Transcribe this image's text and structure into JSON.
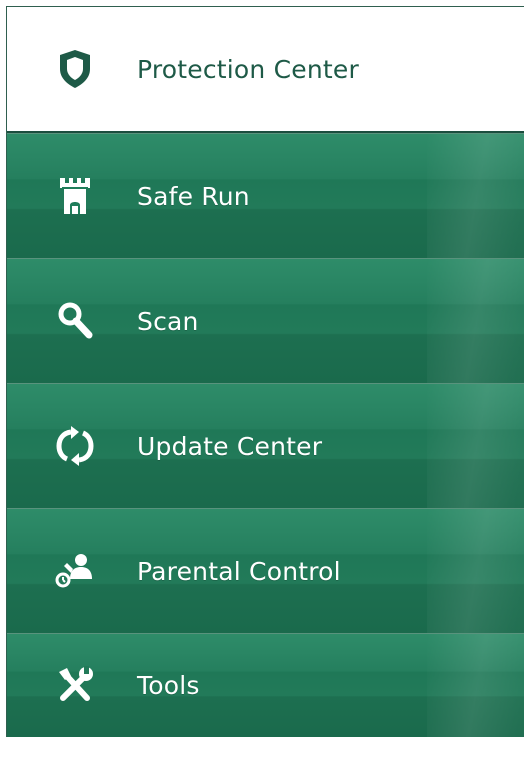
{
  "colors": {
    "accent_green": "#1f7d5a",
    "active_bg": "#ffffff",
    "active_text": "#1e5a47",
    "item_text": "#ffffff"
  },
  "menu": {
    "items": [
      {
        "label": "Protection Center",
        "icon": "shield-icon",
        "active": true
      },
      {
        "label": "Safe Run",
        "icon": "castle-tower-icon",
        "active": false
      },
      {
        "label": "Scan",
        "icon": "magnifier-icon",
        "active": false
      },
      {
        "label": "Update Center",
        "icon": "refresh-icon",
        "active": false
      },
      {
        "label": "Parental Control",
        "icon": "parental-control-icon",
        "active": false
      },
      {
        "label": "Tools",
        "icon": "tools-icon",
        "active": false
      }
    ]
  }
}
